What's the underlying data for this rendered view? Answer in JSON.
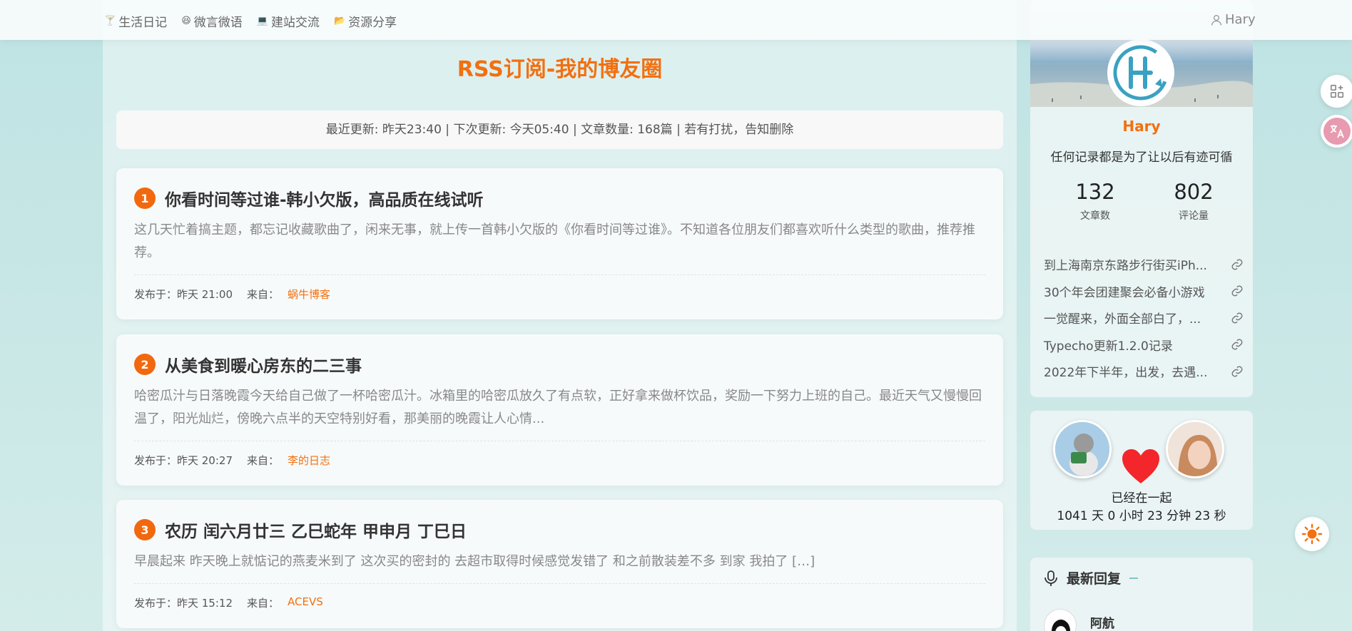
{
  "nav": {
    "items": [
      {
        "icon": "cocktail-icon",
        "glyph": "🍸",
        "label": "生活日记"
      },
      {
        "icon": "grin-icon",
        "glyph": "😆",
        "label": "微言微语"
      },
      {
        "icon": "laptop-icon",
        "glyph": "💻",
        "label": "建站交流"
      },
      {
        "icon": "folder-icon",
        "glyph": "📂",
        "label": "资源分享"
      }
    ],
    "user": "Hary"
  },
  "page": {
    "title": "RSS订阅-我的博友圈",
    "stats": "最近更新: 昨天23:40 | 下次更新: 今天05:40 | 文章数量: 168篇 | 若有打扰，告知删除"
  },
  "articles": [
    {
      "num": "1",
      "title": "你看时间等过谁-韩小欠版，高品质在线试听",
      "excerpt": "这几天忙着搞主题，都忘记收藏歌曲了，闲来无事，就上传一首韩小欠版的《你看时间等过谁》。不知道各位朋友们都喜欢听什么类型的歌曲，推荐推荐。",
      "published_label": "发布于：昨天 21:00",
      "from_label": "来自：",
      "source": "蜗牛博客"
    },
    {
      "num": "2",
      "title": "从美食到暖心房东的二三事",
      "excerpt": "哈密瓜汁与日落晚霞今天给自己做了一杯哈密瓜汁。冰箱里的哈密瓜放久了有点软，正好拿来做杯饮品，奖励一下努力上班的自己。最近天气又慢慢回温了，阳光灿烂，傍晚六点半的天空特别好看，那美丽的晚霞让人心情...",
      "published_label": "发布于：昨天 20:27",
      "from_label": "来自：",
      "source": "李的日志"
    },
    {
      "num": "3",
      "title": "农历 闰六月廿三 乙巳蛇年 甲申月 丁巳日",
      "excerpt": "早晨起来 昨天晚上就惦记的燕麦米到了 这次买的密封的 去超市取得时候感觉发错了 和之前散装差不多 到家 我拍了 […]",
      "published_label": "发布于：昨天 15:12",
      "from_label": "来自：",
      "source": "ACEVS"
    }
  ],
  "profile": {
    "name": "Hary",
    "bio": "任何记录都是为了让以后有迹可循",
    "posts_count": "132",
    "posts_label": "文章数",
    "comments_count": "802",
    "comments_label": "评论量",
    "recent": [
      "到上海南京东路步行街买iPh...",
      "30个年会团建聚会必备小游戏",
      "一觉醒来，外面全部白了，...",
      "Typecho更新1.2.0记录",
      "2022年下半年，出发，去遇..."
    ]
  },
  "love": {
    "together_label": "已经在一起",
    "duration": "1041 天 0 小时 23 分钟 23 秒"
  },
  "replies": {
    "title": "最新回复",
    "first_user": "阿航"
  },
  "colors": {
    "accent": "#f2700f",
    "background": "#c6e6e5"
  }
}
